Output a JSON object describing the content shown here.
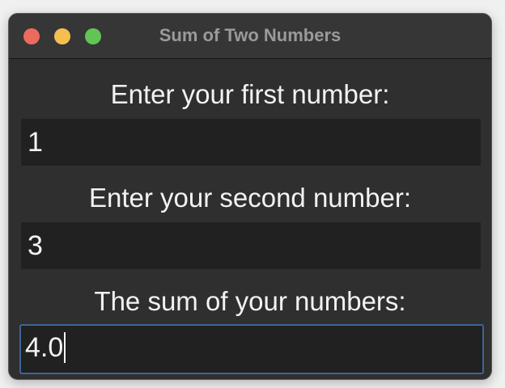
{
  "window": {
    "title": "Sum of Two Numbers"
  },
  "form": {
    "first_label": "Enter your first number:",
    "first_value": "1",
    "second_label": "Enter your second number:",
    "second_value": "3",
    "sum_label": "The sum of your numbers:",
    "sum_value": "4.0"
  },
  "colors": {
    "window_bg": "#2f2f2f",
    "field_bg": "#212121",
    "focus_border": "#3e6496",
    "close": "#ed6a5e",
    "minimize": "#f5bf4f",
    "zoom": "#61c554"
  },
  "icons": {
    "close": "close-button",
    "minimize": "minimize-button",
    "zoom": "zoom-button"
  }
}
